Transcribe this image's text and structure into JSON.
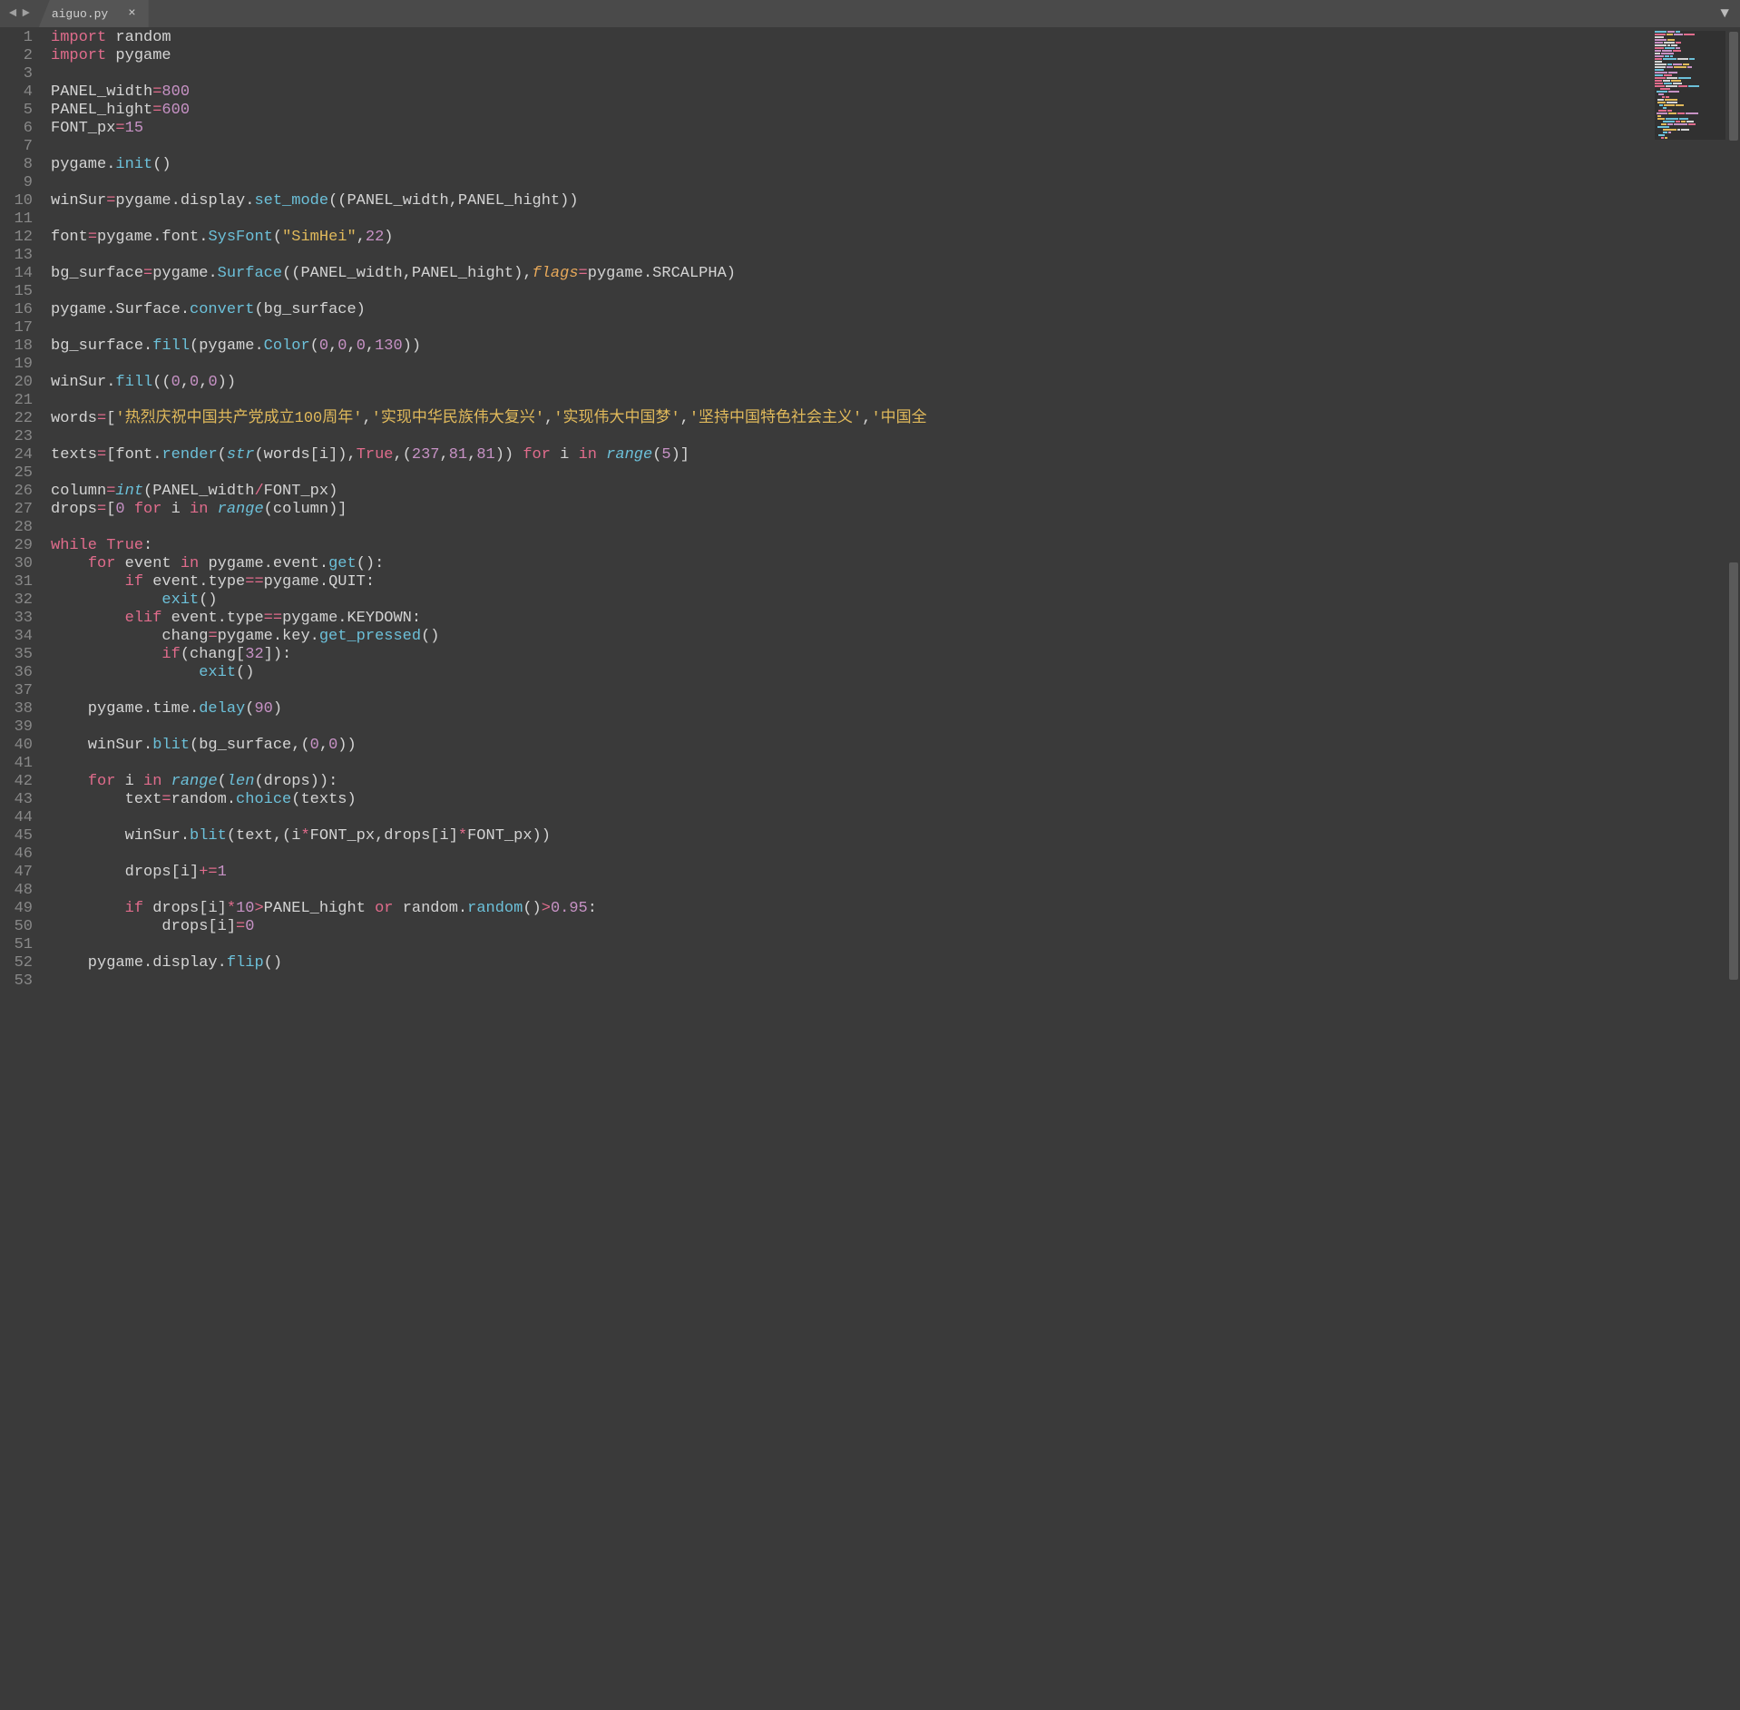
{
  "tab": {
    "filename": "aiguo.py",
    "close": "×"
  },
  "nav": {
    "left": "◄",
    "right": "►",
    "menu": "▼"
  },
  "lines": {
    "l1": {
      "a": "import",
      "b": " random"
    },
    "l2": {
      "a": "import",
      "b": " pygame"
    },
    "l4": {
      "a": "PANEL_width",
      "b": "=",
      "c": "800"
    },
    "l5": {
      "a": "PANEL_hight",
      "b": "=",
      "c": "600"
    },
    "l6": {
      "a": "FONT_px",
      "b": "=",
      "c": "15"
    },
    "l8": {
      "a": "pygame.",
      "b": "init",
      "c": "()"
    },
    "l10": {
      "a": "winSur",
      "b": "=",
      "c": "pygame.display.",
      "d": "set_mode",
      "e": "((PANEL_width,PANEL_hight))"
    },
    "l12": {
      "a": "font",
      "b": "=",
      "c": "pygame.font.",
      "d": "SysFont",
      "e": "(",
      "f": "\"SimHei\"",
      "g": ",",
      "h": "22",
      "i": ")"
    },
    "l14": {
      "a": "bg_surface",
      "b": "=",
      "c": "pygame.",
      "d": "Surface",
      "e": "((PANEL_width,PANEL_hight),",
      "f": "flags",
      "g": "=",
      "h": "pygame.SRCALPHA)"
    },
    "l16": {
      "a": "pygame.Surface.",
      "b": "convert",
      "c": "(bg_surface)"
    },
    "l18": {
      "a": "bg_surface.",
      "b": "fill",
      "c": "(pygame.",
      "d": "Color",
      "e": "(",
      "f": "0",
      "g": ",",
      "h": "0",
      "i": ",",
      "j": "0",
      "k": ",",
      "l": "130",
      "m": "))"
    },
    "l20": {
      "a": "winSur.",
      "b": "fill",
      "c": "((",
      "d": "0",
      "e": ",",
      "f": "0",
      "g": ",",
      "h": "0",
      "i": "))"
    },
    "l22": {
      "a": "words",
      "b": "=",
      "c": "[",
      "d": "'热烈庆祝中国共产党成立100周年'",
      "e": ",",
      "f": "'实现中华民族伟大复兴'",
      "g": ",",
      "h": "'实现伟大中国梦'",
      "i": ",",
      "j": "'坚持中国特色社会主义'",
      "k": ",",
      "l": "'中国全"
    },
    "l24": {
      "a": "texts",
      "b": "=",
      "c": "[font.",
      "d": "render",
      "e": "(",
      "f": "str",
      "g": "(words[i]),",
      "h": "True",
      "i": ",(",
      "j": "237",
      "k": ",",
      "l": "81",
      "m": ",",
      "n": "81",
      "o": ")) ",
      "p": "for",
      "q": " i ",
      "r": "in",
      "s": " ",
      "t": "range",
      "u": "(",
      "v": "5",
      "w": ")]"
    },
    "l26": {
      "a": "column",
      "b": "=",
      "c": "int",
      "d": "(PANEL_width",
      "e": "/",
      "f": "FONT_px)"
    },
    "l27": {
      "a": "drops",
      "b": "=",
      "c": "[",
      "d": "0",
      "e": " ",
      "f": "for",
      "g": " i ",
      "h": "in",
      "i": " ",
      "j": "range",
      "k": "(column)]"
    },
    "l29": {
      "a": "while",
      "b": " ",
      "c": "True",
      "d": ":"
    },
    "l30": {
      "a": "    ",
      "b": "for",
      "c": " event ",
      "d": "in",
      "e": " pygame.event.",
      "f": "get",
      "g": "():"
    },
    "l31": {
      "a": "        ",
      "b": "if",
      "c": " event.type",
      "d": "==",
      "e": "pygame.QUIT:"
    },
    "l32": {
      "a": "            ",
      "b": "exit",
      "c": "()"
    },
    "l33": {
      "a": "        ",
      "b": "elif",
      "c": " event.type",
      "d": "==",
      "e": "pygame.KEYDOWN:"
    },
    "l34": {
      "a": "            chang",
      "b": "=",
      "c": "pygame.key.",
      "d": "get_pressed",
      "e": "()"
    },
    "l35": {
      "a": "            ",
      "b": "if",
      "c": "(chang[",
      "d": "32",
      "e": "]):"
    },
    "l36": {
      "a": "                ",
      "b": "exit",
      "c": "()"
    },
    "l38": {
      "a": "    pygame.time.",
      "b": "delay",
      "c": "(",
      "d": "90",
      "e": ")"
    },
    "l40": {
      "a": "    winSur.",
      "b": "blit",
      "c": "(bg_surface,(",
      "d": "0",
      "e": ",",
      "f": "0",
      "g": "))"
    },
    "l42": {
      "a": "    ",
      "b": "for",
      "c": " i ",
      "d": "in",
      "e": " ",
      "f": "range",
      "g": "(",
      "h": "len",
      "i": "(drops)):"
    },
    "l43": {
      "a": "        text",
      "b": "=",
      "c": "random.",
      "d": "choice",
      "e": "(texts)"
    },
    "l45": {
      "a": "        winSur.",
      "b": "blit",
      "c": "(text,(i",
      "d": "*",
      "e": "FONT_px,drops[i]",
      "f": "*",
      "g": "FONT_px))"
    },
    "l47": {
      "a": "        drops[i]",
      "b": "+=",
      "c": "1"
    },
    "l49": {
      "a": "        ",
      "b": "if",
      "c": " drops[i]",
      "d": "*",
      "e": "10",
      "f": ">",
      "g": "PANEL_hight ",
      "h": "or",
      "i": " random.",
      "j": "random",
      "k": "()",
      "l": ">",
      "m": "0.95",
      "n": ":"
    },
    "l50": {
      "a": "            drops[i]",
      "b": "=",
      "c": "0"
    },
    "l52": {
      "a": "    pygame.display.",
      "b": "flip",
      "c": "()"
    }
  },
  "line_count": 53
}
